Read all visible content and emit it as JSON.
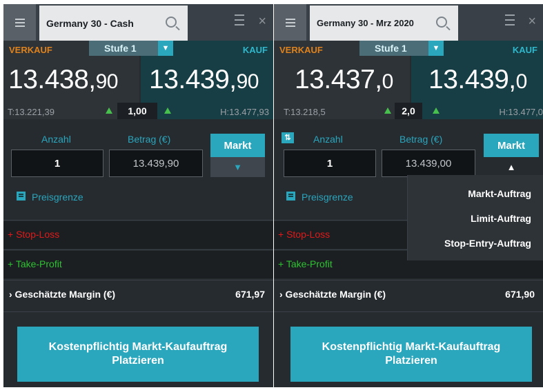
{
  "left": {
    "title": "Germany 30 - Cash",
    "sell_label": "VERKAUF",
    "buy_label": "KAUF",
    "stufe": "Stufe 1",
    "sell_int": "13.438,",
    "sell_dec": "90",
    "buy_int": "13.439,",
    "buy_dec": "90",
    "low": "T:13.221,39",
    "high": "H:13.477,93",
    "spread": "1,00",
    "anzahl_label": "Anzahl",
    "betrag_label": "Betrag (€)",
    "anzahl": "1",
    "betrag": "13.439,90",
    "markt": "Markt",
    "preisgrenze": "Preisgrenze",
    "stop_loss": "+ Stop-Loss",
    "take_profit": "+ Take-Profit",
    "margin_label": "› Geschätzte Margin (€)",
    "margin_value": "671,97",
    "place_line1": "Kostenpflichtig Markt-Kaufauftrag",
    "place_line2": "Platzieren"
  },
  "right": {
    "title": "Germany 30 - Mrz 2020",
    "sell_label": "VERKAUF",
    "buy_label": "KAUF",
    "stufe": "Stufe 1",
    "sell_int": "13.437,",
    "sell_dec": "0",
    "buy_int": "13.439,",
    "buy_dec": "0",
    "low": "T:13.218,5",
    "high": "H:13.477,0",
    "spread": "2,0",
    "anzahl_label": "Anzahl",
    "betrag_label": "Betrag (€)",
    "anzahl": "1",
    "betrag": "13.439,00",
    "markt": "Markt",
    "preisgrenze": "Preisgrenze",
    "stop_loss": "+ Stop-Loss",
    "take_profit": "+ Take-Profit",
    "margin_label": "› Geschätzte Margin (€)",
    "margin_value": "671,90",
    "place_line1": "Kostenpflichtig Markt-Kaufauftrag",
    "place_line2": "Platzieren",
    "order_types": [
      "Markt-Auftrag",
      "Limit-Auftrag",
      "Stop-Entry-Auftrag"
    ]
  },
  "icons": {
    "menu": "hamburger-icon",
    "search": "search-icon",
    "drag": "drag-handle-icon",
    "close": "close-icon",
    "dropdown": "chevron-down-icon",
    "up": "triangle-up-icon",
    "swap": "swap-icon",
    "checkbox": "checkbox-icon",
    "collapse": "chevron-up-icon"
  },
  "colors": {
    "accent": "#2aa6bd",
    "sell": "#e0821b",
    "stop_loss": "#e01a1a",
    "take_profit": "#2fc232"
  }
}
